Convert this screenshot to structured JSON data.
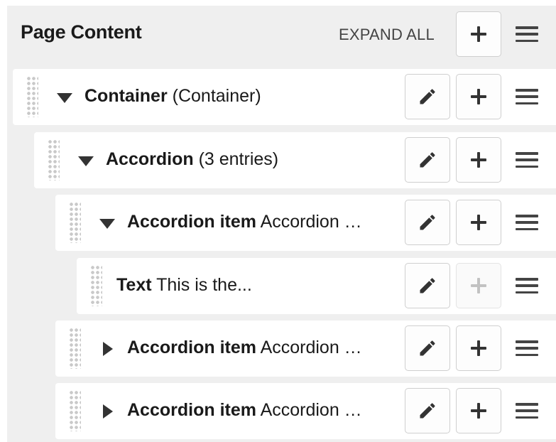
{
  "header": {
    "title": "Page Content",
    "expand_all": "EXPAND ALL"
  },
  "icons": {
    "edit": "pencil-icon",
    "add": "plus-icon",
    "menu": "hamburger-menu-icon",
    "drag": "drag-handle-icon"
  },
  "rows": [
    {
      "name": "Container",
      "detail": "(Container)",
      "caret": "down",
      "add_enabled": true
    },
    {
      "name": "Accordion",
      "detail": "(3 entries)",
      "caret": "down",
      "add_enabled": true
    },
    {
      "name": "Accordion item",
      "detail": "Accordion …",
      "caret": "down",
      "add_enabled": true
    },
    {
      "name": "Text",
      "detail": "This is the...",
      "caret": "none",
      "add_enabled": false
    },
    {
      "name": "Accordion item",
      "detail": "Accordion …",
      "caret": "right",
      "add_enabled": true
    },
    {
      "name": "Accordion item",
      "detail": "Accordion …",
      "caret": "right",
      "add_enabled": true
    }
  ]
}
